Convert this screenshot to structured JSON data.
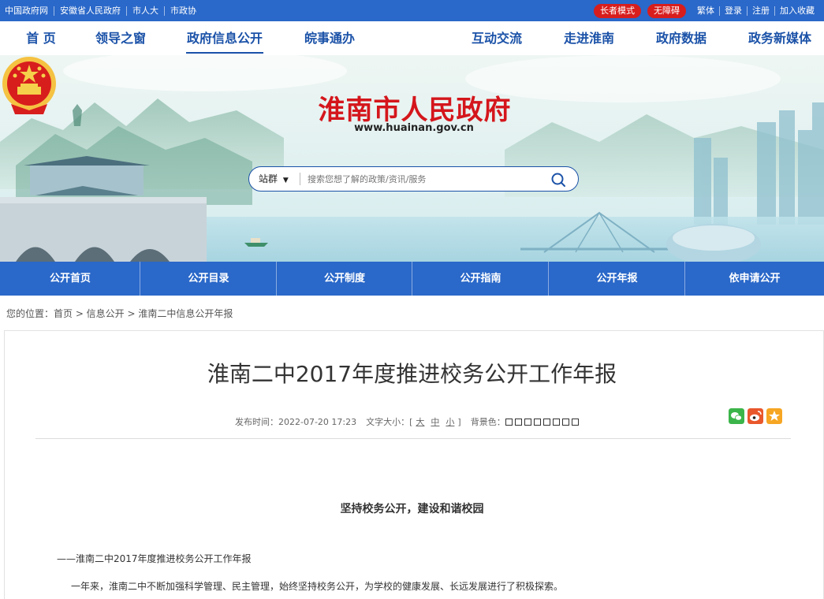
{
  "topbar": {
    "links": [
      "中国政府网",
      "安徽省人民政府",
      "市人大",
      "市政协"
    ],
    "elder_mode": "长者模式",
    "accessible": "无障碍",
    "traditional": "繁体",
    "login": "登录",
    "register": "注册",
    "favorite": "加入收藏"
  },
  "nav": {
    "home": "首 页",
    "leaders": "领导之窗",
    "info_open": "政府信息公开",
    "services": "皖事通办",
    "interaction": "互动交流",
    "about": "走进淮南",
    "data": "政府数据",
    "media": "政务新媒体"
  },
  "banner": {
    "site_name": "淮南市人民政府",
    "site_url": "www.huainan.gov.cn"
  },
  "search": {
    "scope": "站群",
    "placeholder": "搜索您想了解的政策/资讯/服务"
  },
  "subnav": [
    "公开首页",
    "公开目录",
    "公开制度",
    "公开指南",
    "公开年报",
    "依申请公开"
  ],
  "breadcrumb": "您的位置：首页 > 信息公开 > 淮南二中信息公开年报",
  "article": {
    "title": "淮南二中2017年度推进校务公开工作年报",
    "publish_label": "发布时间：",
    "publish_time": "2022-07-20 17:23",
    "font_size_label": "文字大小：[",
    "font_large": "大",
    "font_medium": "中",
    "font_small": "小",
    "font_size_close": "]",
    "bg_label": "背景色：",
    "bg_colors": [
      "#ffffff",
      "#ffffff",
      "#ffffff",
      "#ffffff",
      "#ffffff",
      "#ffffff",
      "#ffffff",
      "#ffffff"
    ],
    "subtitle": "坚持校务公开，建设和谐校园",
    "line1": "——淮南二中2017年度推进校务公开工作年报",
    "line2": "一年来，淮南二中不断加强科学管理、民主管理，始终坚持校务公开，为学校的健康发展、长远发展进行了积极探索。"
  },
  "colors": {
    "primary_blue": "#2a68c9",
    "nav_text": "#1b52a8",
    "title_red": "#d4161c",
    "pill_red": "#d81d1d"
  }
}
